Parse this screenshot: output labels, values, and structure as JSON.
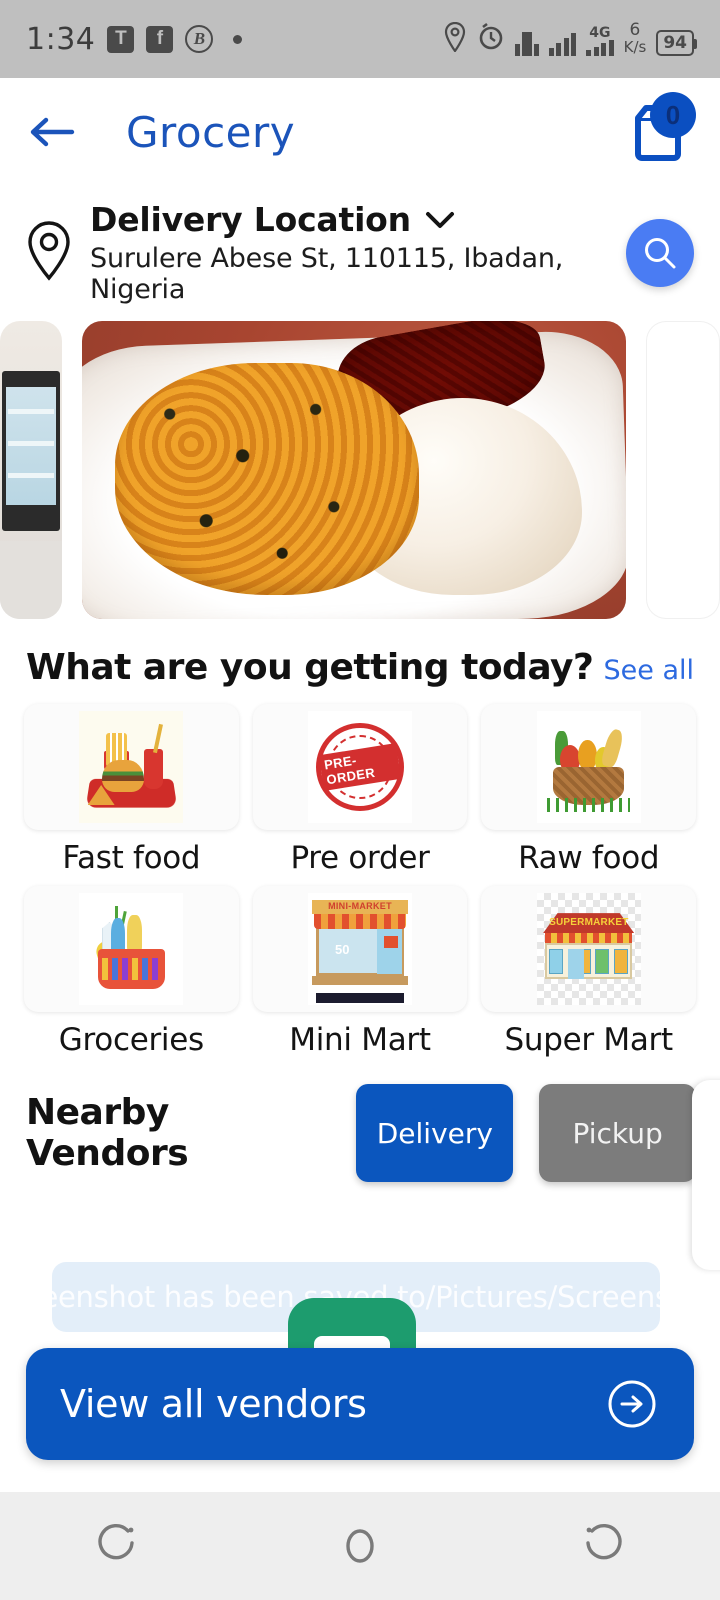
{
  "status_bar": {
    "time": "1:34",
    "app_icons": [
      "T",
      "f",
      "B"
    ],
    "network_label": "4G",
    "data_rate_value": "6",
    "data_rate_unit": "K/s",
    "battery_level": "94"
  },
  "header": {
    "back_icon": "back-arrow-icon",
    "title": "Grocery",
    "cart_icon": "shopping-bag-icon",
    "cart_count": "0"
  },
  "location": {
    "pin_icon": "location-pin-icon",
    "label": "Delivery Location",
    "chevron": "chevron-down-icon",
    "address": "Surulere Abese St, 110115, Ibadan, Nigeria",
    "search_icon": "search-icon"
  },
  "carousel": {
    "slides": [
      {
        "alt": "store-interior-with-refrigerators"
      },
      {
        "alt": "nigerian-dish-egusi-with-pounded-yam-and-meat"
      },
      {
        "alt": "blank-white-card"
      }
    ]
  },
  "categories_section": {
    "title": "What are you getting today?",
    "see_all": "See all",
    "items": [
      {
        "label": "Fast food",
        "icon": "fast-food-tray-icon"
      },
      {
        "label": "Pre order",
        "icon": "pre-order-stamp-icon"
      },
      {
        "label": "Raw food",
        "icon": "vegetable-basket-icon"
      },
      {
        "label": "Groceries",
        "icon": "grocery-basket-icon"
      },
      {
        "label": "Mini Mart",
        "icon": "mini-market-storefront-icon"
      },
      {
        "label": "Super Mart",
        "icon": "supermarket-storefront-icon"
      }
    ]
  },
  "vendors_section": {
    "title": "Nearby Vendors",
    "mode_delivery": "Delivery",
    "mode_pickup": "Pickup",
    "active_mode": "Delivery"
  },
  "toast": {
    "message": "Screenshot has been saved to/Pictures/Screenshot"
  },
  "cta": {
    "label": "View all vendors",
    "icon": "arrow-right-circle-icon"
  },
  "nav_bar": {
    "recents_icon": "recents-icon",
    "home_icon": "home-icon",
    "back_icon": "back-icon"
  },
  "colors": {
    "primary_blue": "#0b56be",
    "title_blue": "#1b54ba",
    "link_blue": "#2d6ae0",
    "search_blue": "#4a7cf3",
    "inactive_gray": "#7c7c7c",
    "status_bar_gray": "#bfbfbf",
    "nav_bar_gray": "#eeeeee",
    "toast_green_app": "#1d9c6e"
  },
  "art_text": {
    "stamp": "PRE-ORDER",
    "mini_market_sign": "MINI-MARKET",
    "mini_market_discount": "50",
    "supermarket_sign": "SUPERMARKET"
  }
}
